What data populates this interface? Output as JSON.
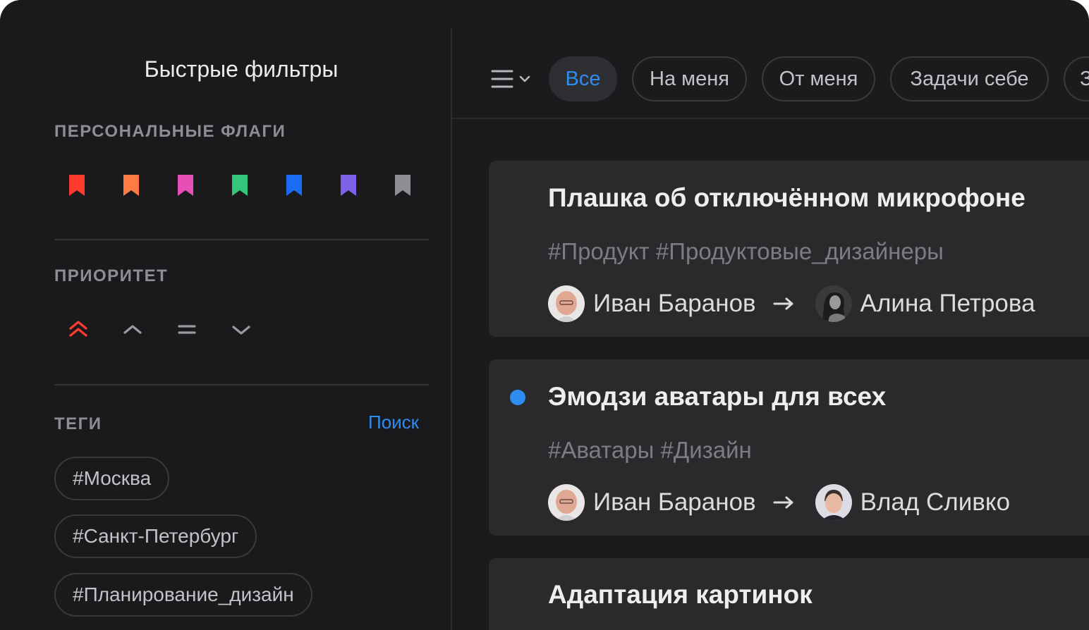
{
  "sidebar": {
    "title": "Быстрые фильтры",
    "flags_label": "ПЕРСОНАЛЬНЫЕ ФЛАГИ",
    "flags": [
      {
        "name": "red-flag-icon",
        "color": "#ff3b30"
      },
      {
        "name": "orange-flag-icon",
        "color": "#ff7a45"
      },
      {
        "name": "pink-flag-icon",
        "color": "#e84fb5"
      },
      {
        "name": "green-flag-icon",
        "color": "#34c77b"
      },
      {
        "name": "blue-flag-icon",
        "color": "#1a6cf5"
      },
      {
        "name": "purple-flag-icon",
        "color": "#7e63e8"
      },
      {
        "name": "gray-flag-icon",
        "color": "#8d8e93"
      }
    ],
    "priority_label": "ПРИОРИТЕТ",
    "priority_icons": [
      "highest-priority-icon",
      "high-priority-icon",
      "medium-priority-icon",
      "low-priority-icon"
    ],
    "tags_label": "ТЕГИ",
    "tags_search": "Поиск",
    "tags": [
      "#Москва",
      "#Санкт-Петербург",
      "#Планирование_дизайн"
    ]
  },
  "filters": {
    "menu_icon": "menu-icon",
    "tabs": [
      "Все",
      "На меня",
      "От меня",
      "Задачи себе",
      "З"
    ],
    "active": "Все"
  },
  "tasks": [
    {
      "title": "Плашка об отключённом микрофоне",
      "tags": "#Продукт #Продуктовые_дизайнеры",
      "from": "Иван Баранов",
      "to": "Алина Петрова",
      "unread": false
    },
    {
      "title": "Эмодзи аватары для всех",
      "tags": "#Аватары #Дизайн",
      "from": "Иван Баранов",
      "to": "Влад Сливко",
      "unread": true
    },
    {
      "title": "Адаптация картинок"
    }
  ],
  "colors": {
    "accent": "#2f8cf0",
    "background": "#1b1b1d",
    "card": "#2a2a2d"
  }
}
